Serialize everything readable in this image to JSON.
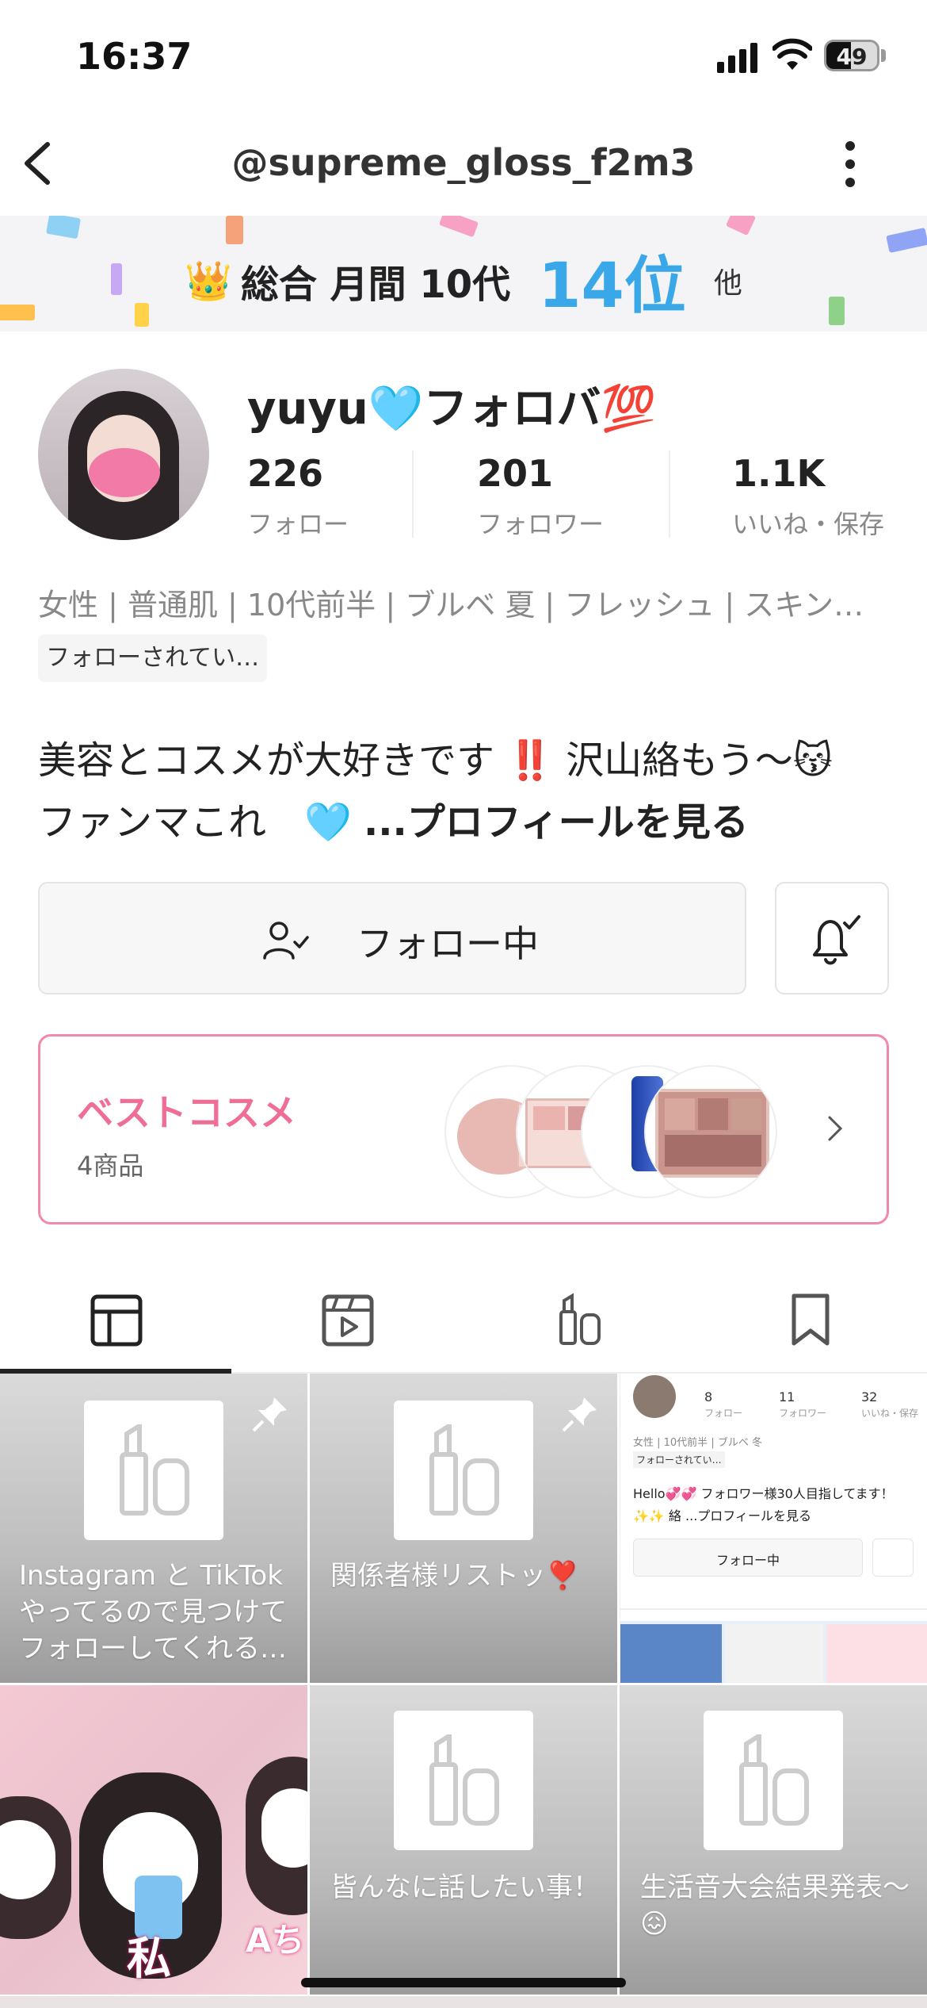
{
  "status": {
    "time": "16:37",
    "battery": "49"
  },
  "nav": {
    "title": "@supreme_gloss_f2m3"
  },
  "ranking": {
    "crown": "👑",
    "label": "総合 月間 10代",
    "rank": "14位",
    "suffix": "他"
  },
  "profile": {
    "name": "yuyu🩵フォロバ💯",
    "stats": [
      {
        "value": "226",
        "label": "フォロー"
      },
      {
        "value": "201",
        "label": "フォロワー"
      },
      {
        "value": "1.1K",
        "label": "いいね・保存"
      }
    ],
    "tags": "女性 | 普通肌 | 10代前半 | ブルベ 夏 | フレッシュ | スキン…",
    "followed_badge": "フォローされてい…",
    "bio_line1": "美容とコスメが大好きです ‼️ 沢山絡もう〜😽",
    "bio_line2_a": "ファンマこれ　🩵 ",
    "bio_more": "...プロフィールを見る"
  },
  "actions": {
    "follow_label": "フォロー中"
  },
  "best_cosme": {
    "title": "ベストコスメ",
    "count": "4商品"
  },
  "posts": [
    {
      "caption": "Instagram と TikTok やってるので見つけて フォローしてくれる…"
    },
    {
      "caption": "関係者様リストッ❣️"
    },
    {
      "caption": ""
    },
    {
      "caption": ""
    },
    {
      "caption": "皆んなに話したい事！"
    },
    {
      "caption": "生活音大会結果発表〜😖"
    }
  ],
  "mini_profile": {
    "stats": [
      {
        "value": "8",
        "label": "フォロー"
      },
      {
        "value": "11",
        "label": "フォロワー"
      },
      {
        "value": "32",
        "label": "いいね・保存"
      }
    ],
    "tags": "女性 | 10代前半 | ブルベ 冬",
    "badge": "フォローされてい…",
    "bio": "Hello💞💞 フォロワー様30人目指してます！✨✨ 絡 ...プロフィールを見る",
    "follow_label": "フォロー中"
  },
  "photo_text": {
    "a": "私",
    "b": "Aち"
  },
  "colors": {
    "accent_blue": "#3aa8e8",
    "accent_pink": "#ef6e95"
  }
}
